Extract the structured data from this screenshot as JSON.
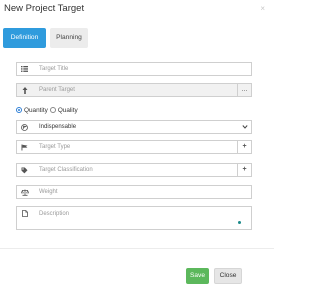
{
  "dialog": {
    "title": "New Project Target",
    "close_glyph": "×"
  },
  "tabs": [
    {
      "label": "Definition",
      "active": true
    },
    {
      "label": "Planning",
      "active": false
    }
  ],
  "form": {
    "target_title": {
      "placeholder": "Target Title",
      "icon": "list-icon"
    },
    "parent_target": {
      "placeholder": "Parent Target",
      "icon": "arrow-up-icon",
      "addon": "..."
    },
    "radio_options": [
      {
        "label": "Quantity",
        "checked": true
      },
      {
        "label": "Quality",
        "checked": false
      }
    ],
    "importance": {
      "value": "Indispensable",
      "icon": "flag-circle-icon"
    },
    "target_type": {
      "placeholder": "Target Type",
      "icon": "flag-icon",
      "addon": "+"
    },
    "target_classification": {
      "placeholder": "Target Classification",
      "icon": "tag-icon",
      "addon": "+"
    },
    "weight": {
      "placeholder": "Weight",
      "icon": "scale-icon"
    },
    "description": {
      "placeholder": "Description",
      "icon": "document-icon"
    }
  },
  "buttons": {
    "save": "Save",
    "close": "Close"
  },
  "colors": {
    "accent": "#2f9bdd",
    "save": "#5cb85c"
  }
}
